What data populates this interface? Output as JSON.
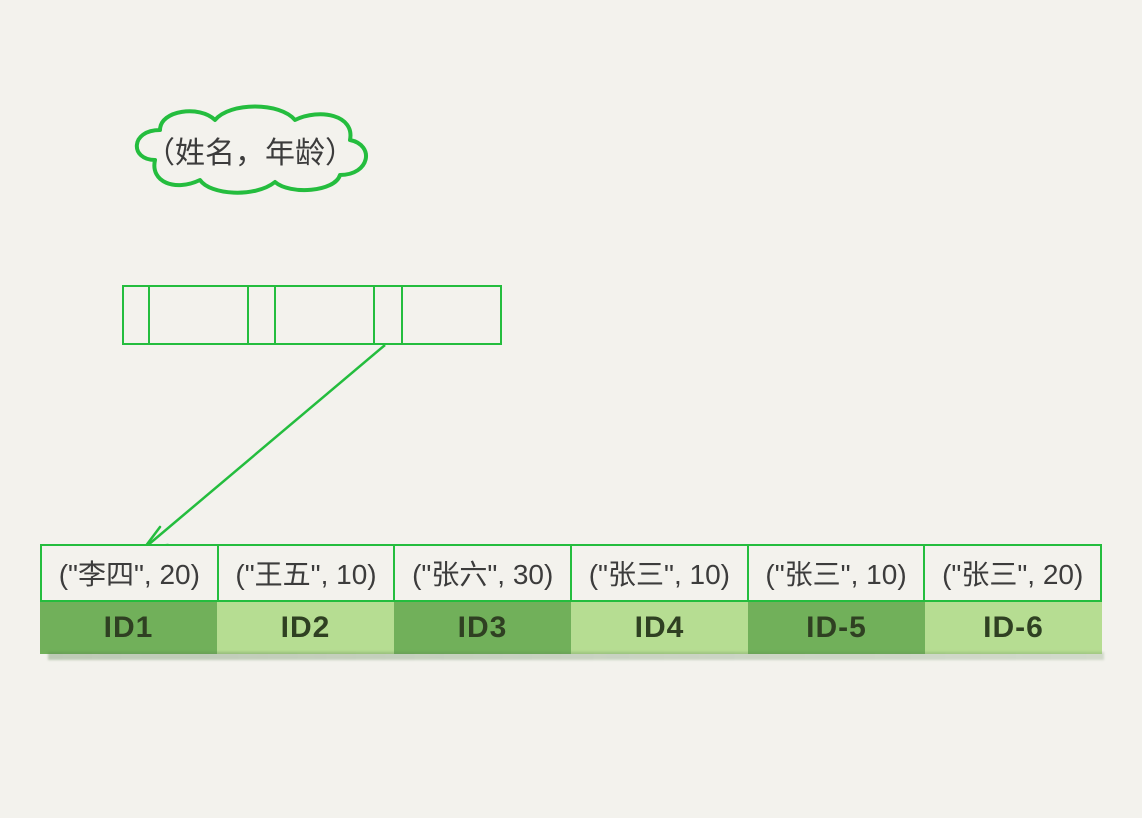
{
  "bubble": {
    "label": "（姓名，年龄）"
  },
  "records": [
    {
      "tuple": "(\"李四\", 20)",
      "id": "ID1"
    },
    {
      "tuple": "(\"王五\", 10)",
      "id": "ID2"
    },
    {
      "tuple": "(\"张六\", 30)",
      "id": "ID3"
    },
    {
      "tuple": "(\"张三\", 10)",
      "id": "ID4"
    },
    {
      "tuple": "(\"张三\", 10)",
      "id": "ID-5"
    },
    {
      "tuple": "(\"张三\", 20)",
      "id": "ID-6"
    }
  ],
  "colors": {
    "stroke": "#24bd3e",
    "id_dark": "#71b05a",
    "id_light": "#b6dd92"
  }
}
